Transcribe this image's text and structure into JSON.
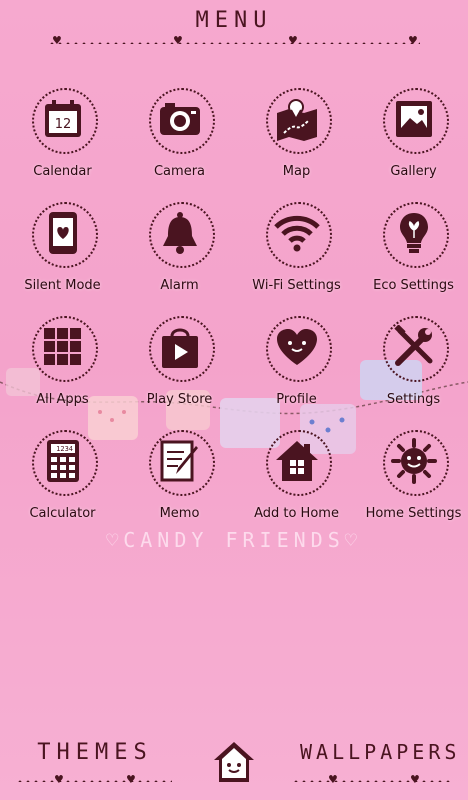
{
  "header": {
    "title": "MENU"
  },
  "apps": [
    {
      "label": "Calendar",
      "icon": "calendar-icon",
      "date": "12"
    },
    {
      "label": "Camera",
      "icon": "camera-icon"
    },
    {
      "label": "Map",
      "icon": "map-icon"
    },
    {
      "label": "Gallery",
      "icon": "gallery-icon"
    },
    {
      "label": "Silent Mode",
      "icon": "phone-heart-icon"
    },
    {
      "label": "Alarm",
      "icon": "bell-icon"
    },
    {
      "label": "Wi-Fi Settings",
      "icon": "wifi-icon"
    },
    {
      "label": "Eco Settings",
      "icon": "lightbulb-icon"
    },
    {
      "label": "All Apps",
      "icon": "grid-icon"
    },
    {
      "label": "Play Store",
      "icon": "shopping-bag-icon"
    },
    {
      "label": "Profile",
      "icon": "heart-face-icon"
    },
    {
      "label": "Settings",
      "icon": "tools-icon"
    },
    {
      "label": "Calculator",
      "icon": "calculator-icon",
      "display": "1234"
    },
    {
      "label": "Memo",
      "icon": "memo-pencil-icon"
    },
    {
      "label": "Add to Home",
      "icon": "house-icon"
    },
    {
      "label": "Home Settings",
      "icon": "sun-face-icon"
    }
  ],
  "watermark": "♡CANDY FRIENDS♡",
  "bottom": {
    "left_label": "THEMES",
    "right_label": "WALLPAPERS",
    "center_icon": "house-face-icon"
  },
  "colors": {
    "background": "#f6a9cf",
    "ink": "#4a1420"
  }
}
